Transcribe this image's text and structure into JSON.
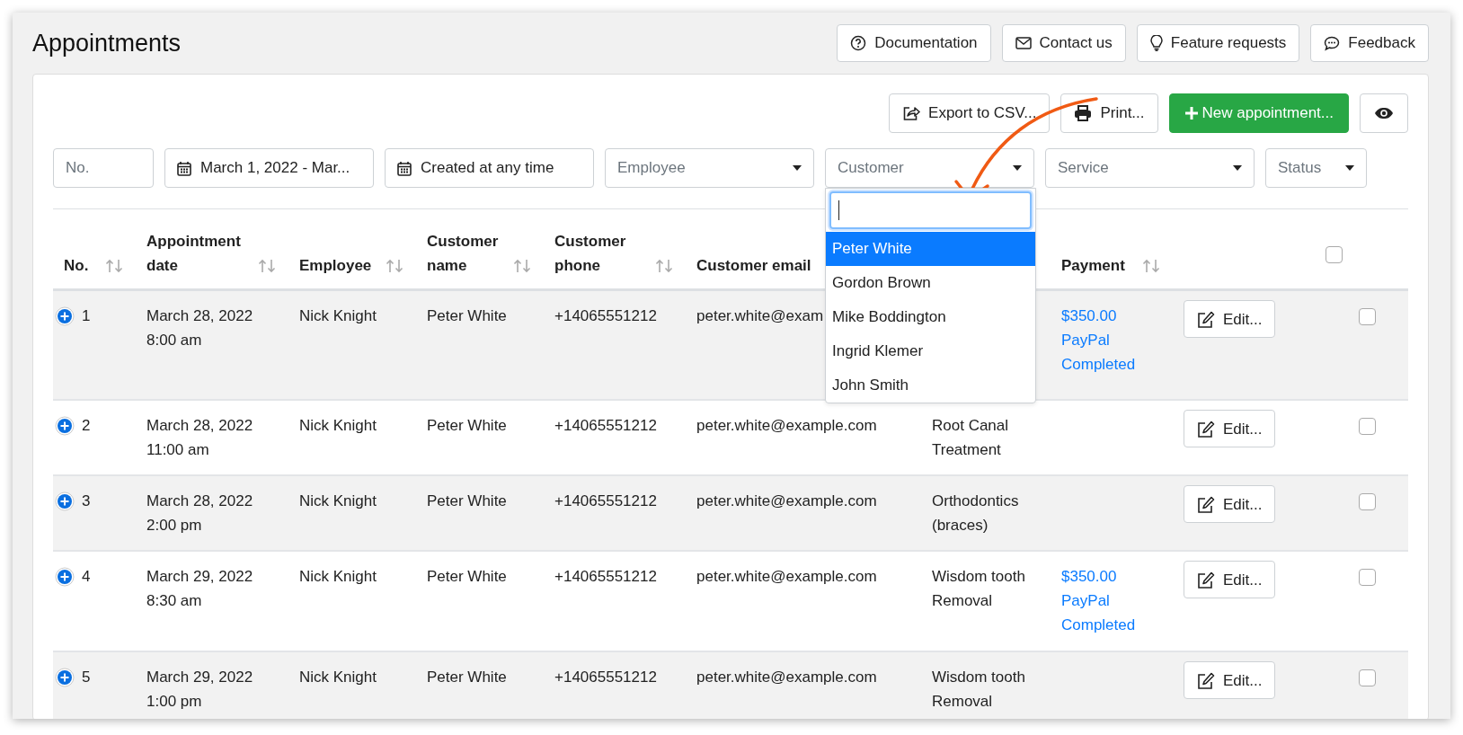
{
  "page_title": "Appointments",
  "help_buttons": [
    {
      "kind": "help",
      "label": "Documentation"
    },
    {
      "kind": "mail",
      "label": "Contact us"
    },
    {
      "kind": "bulb",
      "label": "Feature requests"
    },
    {
      "kind": "chat",
      "label": "Feedback"
    }
  ],
  "toolbar": [
    {
      "kind": "export",
      "label": "Export to CSV..."
    },
    {
      "kind": "print",
      "label": "Print..."
    },
    {
      "kind": "new",
      "label": "New appointment..."
    },
    {
      "kind": "eye"
    }
  ],
  "filters": [
    {
      "kind": "text",
      "placeholder": "No."
    },
    {
      "kind": "date",
      "value": "March 1, 2022 - Mar..."
    },
    {
      "kind": "date",
      "value": "Created at any time"
    },
    {
      "kind": "select",
      "placeholder": "Employee"
    },
    {
      "kind": "select",
      "placeholder": "Customer",
      "open": true
    },
    {
      "kind": "select",
      "placeholder": "Service"
    },
    {
      "kind": "select",
      "placeholder": "Status"
    }
  ],
  "customer_dropdown": {
    "options": [
      {
        "label": "Peter White",
        "selected": true
      },
      {
        "label": "Gordon Brown",
        "selected": false
      },
      {
        "label": "Mike Boddington",
        "selected": false
      },
      {
        "label": "Ingrid Klemer",
        "selected": false
      },
      {
        "label": "John Smith",
        "selected": false
      }
    ]
  },
  "table": {
    "columns": [
      {
        "label": "No.",
        "sortable": true
      },
      {
        "label": "Appointment date",
        "sortable": true
      },
      {
        "label": "Employee",
        "sortable": true
      },
      {
        "label": "Customer name",
        "sortable": true
      },
      {
        "label": "Customer phone",
        "sortable": true
      },
      {
        "label": "Customer email",
        "sortable": false
      },
      {
        "label": "Payment",
        "sortable": true
      }
    ],
    "select_all": {
      "checked": false
    },
    "rows": [
      {
        "no": "1",
        "date": "March 28, 2022",
        "time": "8:00 am",
        "employee": "Nick Knight",
        "customer": "Peter White",
        "phone": "+14065551212",
        "email": "peter.white@exam",
        "service": [],
        "payment": [
          "$350.00",
          "PayPal",
          "Completed"
        ],
        "edit": "Edit...",
        "checked": false
      },
      {
        "no": "2",
        "date": "March 28, 2022",
        "time": "11:00 am",
        "employee": "Nick Knight",
        "customer": "Peter White",
        "phone": "+14065551212",
        "email": "peter.white@example.com",
        "service": [
          "Root Canal",
          "Treatment"
        ],
        "payment": [],
        "edit": "Edit...",
        "checked": false
      },
      {
        "no": "3",
        "date": "March 28, 2022",
        "time": "2:00 pm",
        "employee": "Nick Knight",
        "customer": "Peter White",
        "phone": "+14065551212",
        "email": "peter.white@example.com",
        "service": [
          "Orthodontics",
          "(braces)"
        ],
        "payment": [],
        "edit": "Edit...",
        "checked": false
      },
      {
        "no": "4",
        "date": "March 29, 2022",
        "time": "8:30 am",
        "employee": "Nick Knight",
        "customer": "Peter White",
        "phone": "+14065551212",
        "email": "peter.white@example.com",
        "service": [
          "Wisdom tooth",
          "Removal"
        ],
        "payment": [
          "$350.00",
          "PayPal",
          "Completed"
        ],
        "edit": "Edit...",
        "checked": false
      },
      {
        "no": "5",
        "date": "March 29, 2022",
        "time": "1:00 pm",
        "employee": "Nick Knight",
        "customer": "Peter White",
        "phone": "+14065551212",
        "email": "peter.white@example.com",
        "service": [
          "Wisdom tooth",
          "Removal"
        ],
        "payment": [],
        "edit": "Edit...",
        "checked": false
      }
    ]
  }
}
